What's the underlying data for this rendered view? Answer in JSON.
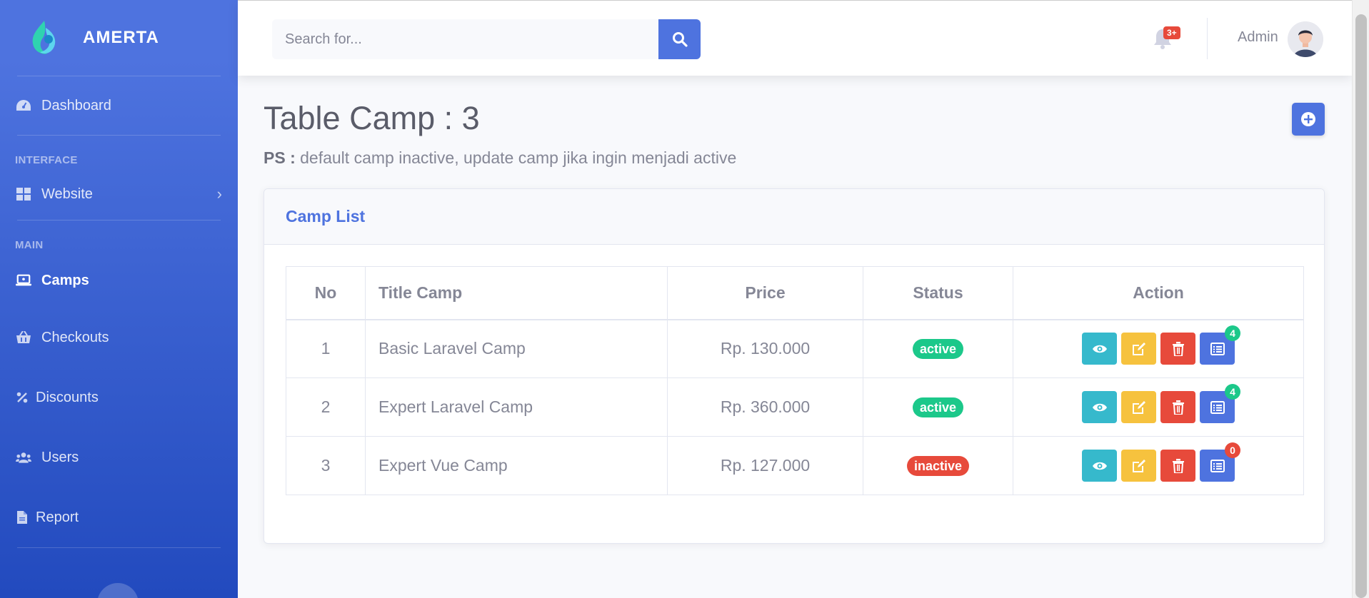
{
  "brand": {
    "name": "AMERTA"
  },
  "sidebar": {
    "dashboard": {
      "label": "Dashboard",
      "icon": "tachometer-icon"
    },
    "heading_interface": "INTERFACE",
    "website": {
      "label": "Website",
      "icon": "grid-icon"
    },
    "heading_main": "MAIN",
    "items": [
      {
        "label": "Camps",
        "icon": "laptop-icon",
        "active": true
      },
      {
        "label": "Checkouts",
        "icon": "basket-icon"
      },
      {
        "label": "Discounts",
        "icon": "percent-icon"
      },
      {
        "label": "Users",
        "icon": "users-icon"
      },
      {
        "label": "Report",
        "icon": "file-icon"
      }
    ]
  },
  "topbar": {
    "search_placeholder": "Search for...",
    "notification_count": "3+",
    "user_name": "Admin"
  },
  "page": {
    "title": "Table Camp : 3",
    "note_label": "PS :",
    "note_text": " default camp inactive, update camp jika ingin menjadi active"
  },
  "card": {
    "title": "Camp List",
    "columns": [
      "No",
      "Title Camp",
      "Price",
      "Status",
      "Action"
    ],
    "rows": [
      {
        "no": "1",
        "title": "Basic Laravel Camp",
        "price": "Rp. 130.000",
        "status": "active",
        "count": "4"
      },
      {
        "no": "2",
        "title": "Expert Laravel Camp",
        "price": "Rp. 360.000",
        "status": "active",
        "count": "4"
      },
      {
        "no": "3",
        "title": "Expert Vue Camp",
        "price": "Rp. 127.000",
        "status": "inactive",
        "count": "0"
      }
    ]
  },
  "colors": {
    "primary": "#4e73df",
    "active": "#1cc88a",
    "inactive": "#e74a3b",
    "view": "#36b9cc",
    "edit": "#f6c23e",
    "delete": "#e74a3b"
  }
}
